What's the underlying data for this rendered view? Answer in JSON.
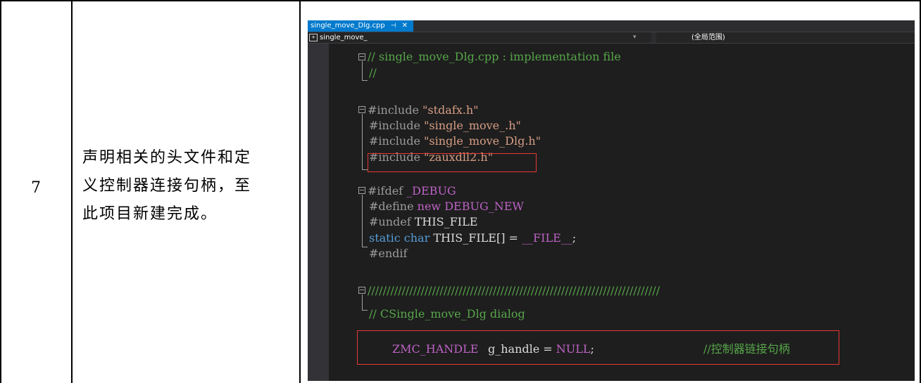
{
  "row": {
    "step_number": "7",
    "description_lines": [
      "声明相关的头文件和定",
      "义控制器连接句柄，至",
      "此项目新建完成。"
    ]
  },
  "ide": {
    "tab": {
      "label": "single_move_Dlg.cpp",
      "pin_icon": "pin-icon",
      "close_icon": "close-icon"
    },
    "nav": {
      "scope": "single_move_",
      "member": "(全局范围)",
      "dropdown_icon": "chevron-down-icon"
    },
    "code": {
      "line1": "// single_move_Dlg.cpp : implementation file",
      "line2": "//",
      "inc1_kw": "#include ",
      "inc1_str": "\"stdafx.h\"",
      "inc2_kw": "#include ",
      "inc2_str": "\"single_move_.h\"",
      "inc3_kw": "#include ",
      "inc3_str": "\"single_move_Dlg.h\"",
      "inc4_kw": "#include ",
      "inc4_str": "\"zauxdll2.h\"",
      "ifdef_kw": "#ifdef ",
      "ifdef_macro": "_DEBUG",
      "define_kw": "#define ",
      "define_new": "new ",
      "define_macro": "DEBUG_NEW",
      "undef_kw": "#undef ",
      "undef_macro": "THIS_FILE",
      "static_kw": "static ",
      "char_kw": "char ",
      "static_rest": "THIS_FILE[] = ",
      "static_macro": "__FILE__",
      "static_end": ";",
      "endif": "#endif",
      "slashes": "/////////////////////////////////////////////////////////////////////////////",
      "dialog_comment": "// CSingle_move_Dlg dialog",
      "handle_type": "ZMC_HANDLE",
      "handle_decl": "g_handle = ",
      "handle_null": "NULL",
      "handle_end": ";",
      "handle_comment": "//控制器链接句柄"
    },
    "colors": {
      "background": "#1e1e1e",
      "comment": "#57a64a",
      "string": "#d69d85",
      "macro": "#bd63c5",
      "keyword": "#569cd6",
      "type": "#4ec9b0",
      "highlight_box": "#e53935",
      "tab_active": "#007acc"
    }
  }
}
